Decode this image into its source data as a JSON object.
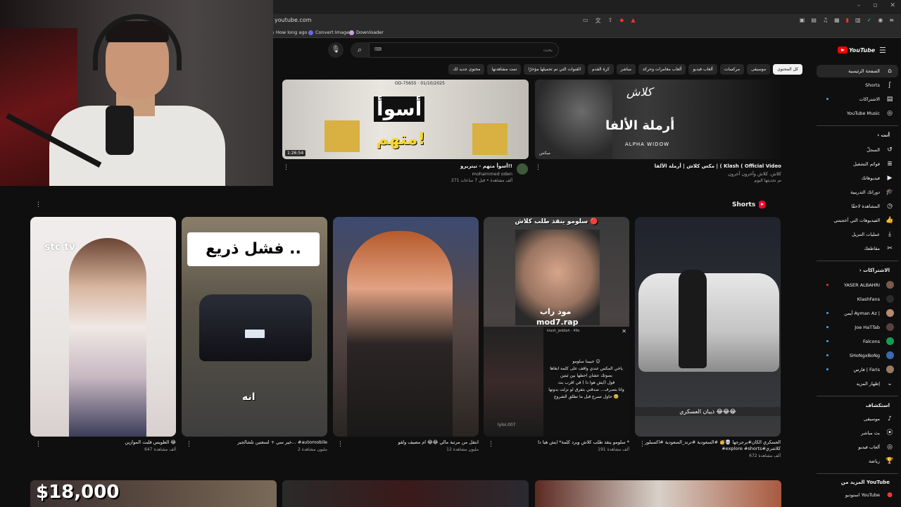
{
  "browser": {
    "url": "youtube.com",
    "bookmarks": [
      "How long ago",
      "Convert Image",
      "Downloader"
    ]
  },
  "topbar": {
    "search_placeholder": "بحث",
    "logo_text": "YouTube",
    "keyboard_icon": "keyboard-icon"
  },
  "chips": [
    "كل المحتوى",
    "موسيقى",
    "مركسات",
    "ألعاب فيديو",
    "ألعاب مغامرات وحركة",
    "مباشر",
    "كرة القدم",
    "القنوات التي تم تحميلها مؤخرًا",
    "تمت مشاهدتها",
    "محتوى جديد لك"
  ],
  "sidebar": {
    "main": [
      {
        "label": "الصفحة الرئيسية",
        "icon": "home-icon",
        "active": true
      },
      {
        "label": "Shorts",
        "icon": "shorts-icon"
      },
      {
        "label": "الاشتراكات",
        "icon": "subscriptions-icon"
      },
      {
        "label": "YouTube Music",
        "icon": "music-icon"
      }
    ],
    "you_heading": "أنت",
    "you": [
      {
        "label": "السجلّ",
        "icon": "history-icon"
      },
      {
        "label": "قوائم التشغيل",
        "icon": "playlist-icon"
      },
      {
        "label": "فيديوهاتك",
        "icon": "your-videos-icon"
      },
      {
        "label": "دوراتك التدريبية",
        "icon": "courses-icon"
      },
      {
        "label": "المشاهدة لاحقًا",
        "icon": "watch-later-icon"
      },
      {
        "label": "الفيديوهات التي أعجبتني",
        "icon": "like-icon"
      },
      {
        "label": "عمليات التنزيل",
        "icon": "download-icon"
      },
      {
        "label": "مقاطعك",
        "icon": "clips-icon"
      }
    ],
    "subs_heading": "الاشتراكات",
    "subs": [
      {
        "label": "YASER ALBAHRI",
        "color": "#7a5a4a"
      },
      {
        "label": "KlashFans",
        "color": "#2b2b2b"
      },
      {
        "label": "أيمن Ayman Az |",
        "color": "#b88a70"
      },
      {
        "label": "Joe HaTTab",
        "color": "#5a4040"
      },
      {
        "label": "Falcons",
        "color": "#10a050"
      },
      {
        "label": "SHoNgxBoNg",
        "color": "#3a6ab0"
      },
      {
        "label": "فارس | Faris",
        "color": "#9a7a60"
      }
    ],
    "show_more": "إظهار المزيد",
    "explore_heading": "استكشاف",
    "explore": [
      {
        "label": "موسيقى",
        "icon": "music-note-icon"
      },
      {
        "label": "بث مباشر",
        "icon": "live-icon"
      },
      {
        "label": "ألعاب فيديو",
        "icon": "gaming-icon"
      },
      {
        "label": "رياضة",
        "icon": "trophy-icon"
      }
    ],
    "more_heading": "المزيد من YouTube",
    "more": [
      {
        "label": "استوديو YouTube",
        "icon": "studio-icon"
      }
    ]
  },
  "videos": [
    {
      "title": "أسوأ متهم - تيتريرو!!",
      "channel": "mohammed oden",
      "stats": "271 ألف مشاهدة • قبل 7 ساعات",
      "duration": "1:26:54",
      "thumb_title": "أسوأ",
      "thumb_sub": "متهم!",
      "thumb_caption": "OD-75655 · 01/10/2025"
    },
    {
      "title": "مكس كلاش | أرملة الألفا | ( Klash ( Official Video",
      "channel": "كلاش، كلاش وآخرون آخرون",
      "stats": "تم تحديثها اليوم",
      "thumb_top": "كلاش",
      "thumb_title": "أرملة الألفا",
      "thumb_sub": "ALPHA WIDOW",
      "thumb_channel": "ميكس"
    }
  ],
  "shorts": {
    "heading": "Shorts",
    "items": [
      {
        "title": "الطويس قلبت الموازين 😂",
        "views": "647 ألف مشاهدة",
        "overlay": "stc tv"
      },
      {
        "title": "خير سي + لسعتين تلشالجير... #automobile",
        "views": "2 مليون مشاهدة",
        "cap_top": "فشل ذريع ..",
        "cap_bottom": "انه"
      },
      {
        "title": "انتقل من مرتبة مالي 😂😂 ام مصيف ولقو",
        "views": "12 مليون مشاهدة"
      },
      {
        "title": "سلومو ينقذ طلب كلاش ويرد كلمة* ايش هيا دا *",
        "views": "191 ألف مشاهدة",
        "cap_top": "سلومو ينقذ طلب كلاش 🔴",
        "watermark_ar": "مود راب",
        "watermark": "mod7.rap",
        "panel_header": "klash_jeddah · 49s",
        "panel_body": [
          "حبيبنا سلومو 😊",
          "ياخي المكس عندي واقف على كلمة ابغاها بصوتك عشان احطها بين ثيتين",
          "قول (ايش هوا دا ) في اقرب بث",
          "وانا بتصرف... صدقني بتفرق لو نزلت بدونها",
          "حاول تسرع قبل ما تطلق الشروع 🥹"
        ],
        "blur_user": "lyloi.007"
      },
      {
        "title": "العسكري الكان#برجرجها 💀🥳 #السعودية #ترند_السعودية #اكسبلور #explore #shorts#كلاشري",
        "views": "672 ألف مشاهدة",
        "cap": "ذيبان العسكري 😂😂😂"
      }
    ]
  },
  "bottom_row": [
    {
      "thumb_text": "$18,000"
    },
    {
      "thumb_text": ""
    },
    {
      "thumb_text": ""
    }
  ],
  "colors": {
    "bg": "#0f0f0f",
    "chip": "#272727",
    "accent_red": "#ff0000",
    "text": "#f1f1f1",
    "muted": "#aaaaaa"
  }
}
